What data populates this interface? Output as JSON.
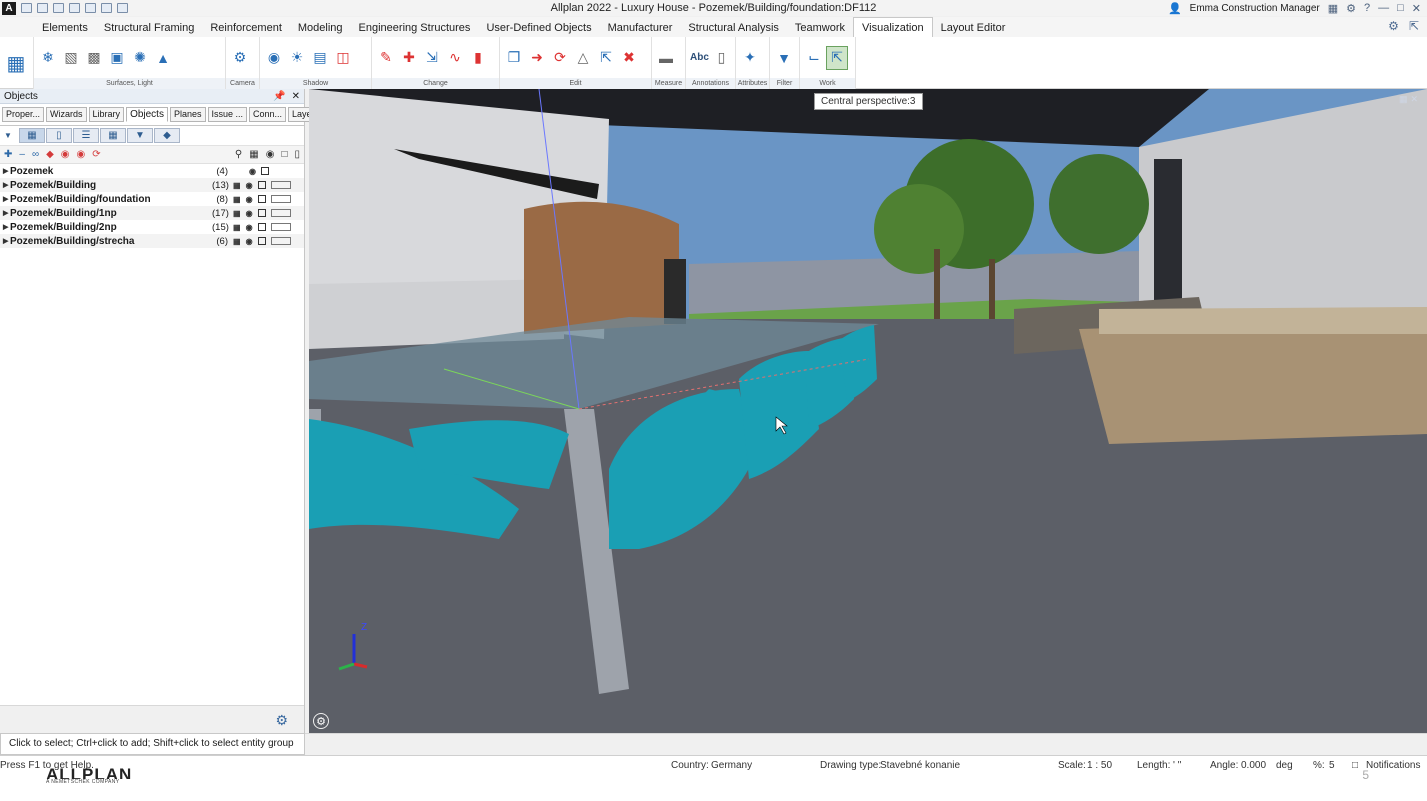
{
  "titlebar": {
    "title": "Allplan 2022 - Luxury House - Pozemek/Building/foundation:DF112",
    "user": "Emma Construction Manager"
  },
  "menu": {
    "tabs": [
      "Elements",
      "Structural Framing",
      "Reinforcement",
      "Modeling",
      "Engineering Structures",
      "User-Defined Objects",
      "Manufacturer",
      "Structural Analysis",
      "Teamwork",
      "Visualization",
      "Layout Editor"
    ],
    "active": "Visualization"
  },
  "ribbon": {
    "groups": [
      {
        "label": "Surfaces, Light",
        "icon": "surfaces-light-icon"
      },
      {
        "label": "Camera",
        "icon": "camera-icon"
      },
      {
        "label": "Shadow",
        "icon": "shadow-icon"
      },
      {
        "label": "Change",
        "icon": "change-icon"
      },
      {
        "label": "Edit",
        "icon": "edit-icon"
      },
      {
        "label": "Measure",
        "icon": "measure-icon"
      },
      {
        "label": "Annotations",
        "icon": "annotations-icon"
      },
      {
        "label": "Attributes",
        "icon": "attributes-icon"
      },
      {
        "label": "Filter",
        "icon": "filter-icon"
      },
      {
        "label": "Work Environment",
        "icon": "work-environment-icon"
      }
    ],
    "annotation_label": "Abc"
  },
  "panel": {
    "title": "Objects",
    "tabs": [
      "Proper...",
      "Wizards",
      "Library",
      "Objects",
      "Planes",
      "Issue ...",
      "Conn...",
      "Layers"
    ],
    "active_tab": "Objects",
    "tree": [
      {
        "name": "Pozemek",
        "count": "(4)"
      },
      {
        "name": "Pozemek/Building",
        "count": "(13)"
      },
      {
        "name": "Pozemek/Building/foundation",
        "count": "(8)"
      },
      {
        "name": "Pozemek/Building/1np",
        "count": "(17)"
      },
      {
        "name": "Pozemek/Building/2np",
        "count": "(15)"
      },
      {
        "name": "Pozemek/Building/strecha",
        "count": "(6)"
      }
    ]
  },
  "viewport": {
    "tooltip": "Central perspective:3",
    "axis_label": "Z"
  },
  "message": "Click to select; Ctrl+click to add; Shift+click to select entity group",
  "status": {
    "help": "Press F1 to get Help.",
    "country_label": "Country:",
    "country": "Germany",
    "drawing_type_label": "Drawing type:",
    "drawing_type": "Stavebné konanie",
    "scale_label": "Scale:",
    "scale": "1 : 50",
    "length_label": "Length:",
    "length": "' \"",
    "angle_label": "Angle:",
    "angle": "0.000",
    "angle_unit": "deg",
    "percent_label": "%:",
    "percent": "5",
    "notifications": "Notifications",
    "page": "5"
  },
  "brand": {
    "name": "ALLPLAN",
    "subtitle": "A NEMETSCHEK COMPANY"
  },
  "colors": {
    "chair": "#1a9fb4",
    "sky": "#6d97c8",
    "floor": "#5c5f67",
    "accent_active": "#cfe5c9"
  }
}
